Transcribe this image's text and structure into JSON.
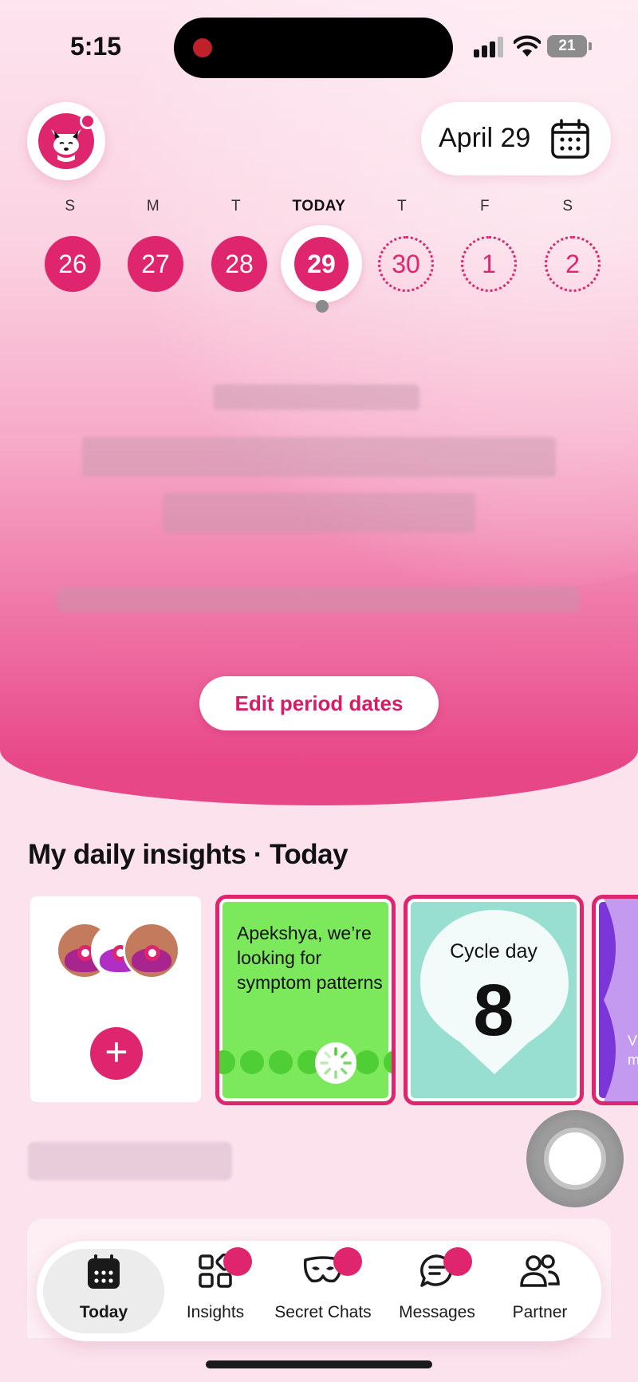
{
  "status_bar": {
    "time": "5:15",
    "battery": "21"
  },
  "header": {
    "date": "April 29"
  },
  "week": {
    "labels": [
      "S",
      "M",
      "T",
      "TODAY",
      "T",
      "F",
      "S"
    ],
    "days": [
      "26",
      "27",
      "28",
      "29",
      "30",
      "1",
      "2"
    ]
  },
  "hero": {
    "edit_button": "Edit period dates"
  },
  "insights": {
    "title": "My daily insights · Today",
    "pattern_card_text": "Apekshya, we’re looking for symptom patterns",
    "cycle_label": "Cycle day",
    "cycle_day": "8",
    "peek_text": "V\nme"
  },
  "tabs": [
    {
      "label": "Today",
      "icon": "calendar-icon",
      "active": true
    },
    {
      "label": "Insights",
      "icon": "grid-icon",
      "badge": true
    },
    {
      "label": "Secret Chats",
      "icon": "mask-icon",
      "badge": true
    },
    {
      "label": "Messages",
      "icon": "chat-icon",
      "badge": true
    },
    {
      "label": "Partner",
      "icon": "people-icon"
    }
  ],
  "colors": {
    "accent": "#e0256f",
    "green_card": "#7ce85c",
    "teal_card": "#98dfd2",
    "purple_card": "#7a36d8"
  }
}
